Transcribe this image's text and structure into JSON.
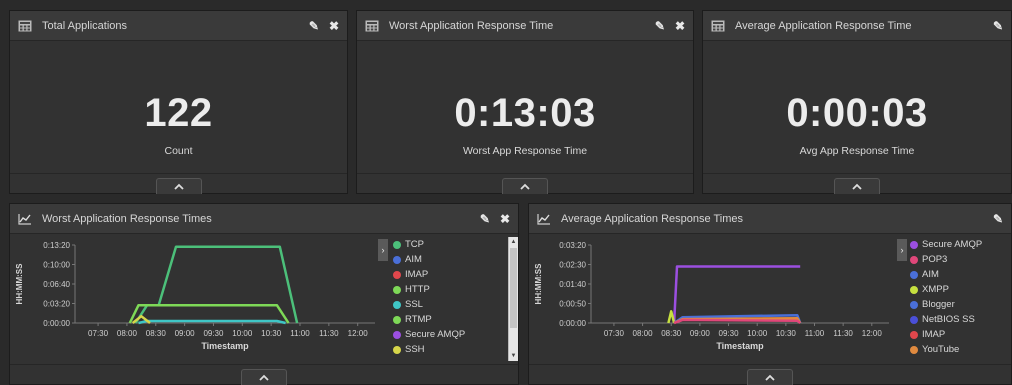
{
  "widgets": {
    "total_apps": {
      "title": "Total Applications",
      "value": "122",
      "label": "Count"
    },
    "worst_time": {
      "title": "Worst Application Response Time",
      "value": "0:13:03",
      "label": "Worst App Response Time"
    },
    "avg_time": {
      "title": "Average Application Response Time",
      "value": "0:00:03",
      "label": "Avg App Response Time"
    },
    "worst_chart": {
      "title": "Worst Application Response Times",
      "legend": [
        {
          "label": "TCP",
          "color": "#4cc07a"
        },
        {
          "label": "AIM",
          "color": "#4a6fd8"
        },
        {
          "label": "IMAP",
          "color": "#e0474c"
        },
        {
          "label": "HTTP",
          "color": "#7ed957"
        },
        {
          "label": "SSL",
          "color": "#3fc6c6"
        },
        {
          "label": "RTMP",
          "color": "#7ed957"
        },
        {
          "label": "Secure AMQP",
          "color": "#9b4fe0"
        },
        {
          "label": "SSH",
          "color": "#d6d64a"
        }
      ]
    },
    "avg_chart": {
      "title": "Average Application Response Times",
      "legend": [
        {
          "label": "Secure AMQP",
          "color": "#9b4fe0"
        },
        {
          "label": "POP3",
          "color": "#e0477a"
        },
        {
          "label": "AIM",
          "color": "#4a6fd8"
        },
        {
          "label": "XMPP",
          "color": "#c6e03f"
        },
        {
          "label": "Blogger",
          "color": "#4a6fd8"
        },
        {
          "label": "NetBIOS SS",
          "color": "#4a4fd8"
        },
        {
          "label": "IMAP",
          "color": "#e0474c"
        },
        {
          "label": "YouTube",
          "color": "#e08a3f"
        }
      ]
    }
  },
  "chart_data": [
    {
      "type": "line",
      "title": "Worst Application Response Times",
      "xlabel": "Timestamp",
      "ylabel": "HH:MM:SS",
      "x_ticks": [
        "07:30",
        "08:00",
        "08:30",
        "09:00",
        "09:30",
        "10:00",
        "10:30",
        "11:00",
        "11:30",
        "12:00"
      ],
      "y_ticks": [
        "0:00:00",
        "0:03:20",
        "0:06:40",
        "0:10:00",
        "0:13:20"
      ],
      "y_range_seconds": [
        0,
        800
      ],
      "x_range_hours": [
        7.1,
        12.3
      ],
      "series": [
        {
          "name": "TCP",
          "color": "#4cc07a",
          "points": [
            [
              8.15,
              0
            ],
            [
              8.35,
              183
            ],
            [
              8.55,
              183
            ],
            [
              8.85,
              783
            ],
            [
              10.65,
              783
            ],
            [
              10.95,
              0
            ]
          ]
        },
        {
          "name": "HTTP",
          "color": "#7ed957",
          "points": [
            [
              8.05,
              0
            ],
            [
              8.2,
              183
            ],
            [
              10.6,
              183
            ],
            [
              10.8,
              0
            ]
          ]
        },
        {
          "name": "SSL",
          "color": "#3fc6c6",
          "points": [
            [
              8.2,
              0
            ],
            [
              8.35,
              20
            ],
            [
              10.6,
              20
            ],
            [
              10.75,
              0
            ]
          ]
        },
        {
          "name": "SSH",
          "color": "#d6d64a",
          "points": [
            [
              8.1,
              0
            ],
            [
              8.25,
              70
            ],
            [
              8.4,
              0
            ]
          ]
        }
      ]
    },
    {
      "type": "line",
      "title": "Average Application Response Times",
      "xlabel": "Timestamp",
      "ylabel": "HH:MM:SS",
      "x_ticks": [
        "07:30",
        "08:00",
        "08:30",
        "09:00",
        "09:30",
        "10:00",
        "10:30",
        "11:00",
        "11:30",
        "12:00"
      ],
      "y_ticks": [
        "0:00:00",
        "0:00:50",
        "0:01:40",
        "0:02:30",
        "0:03:20"
      ],
      "y_range_seconds": [
        0,
        200
      ],
      "x_range_hours": [
        7.1,
        12.3
      ],
      "series": [
        {
          "name": "Secure AMQP",
          "color": "#9b4fe0",
          "points": [
            [
              8.55,
              0
            ],
            [
              8.6,
              145
            ],
            [
              10.75,
              145
            ]
          ]
        },
        {
          "name": "XMPP",
          "color": "#c6e03f",
          "points": [
            [
              8.45,
              0
            ],
            [
              8.5,
              30
            ],
            [
              8.55,
              0
            ]
          ]
        },
        {
          "name": "AIM",
          "color": "#4a6fd8",
          "points": [
            [
              8.55,
              0
            ],
            [
              8.7,
              15
            ],
            [
              10.7,
              20
            ],
            [
              10.75,
              0
            ]
          ]
        },
        {
          "name": "YouTube",
          "color": "#e08a3f",
          "points": [
            [
              8.55,
              0
            ],
            [
              8.7,
              10
            ],
            [
              10.7,
              12
            ],
            [
              10.75,
              0
            ]
          ]
        },
        {
          "name": "POP3",
          "color": "#e0477a",
          "points": [
            [
              8.55,
              0
            ],
            [
              8.7,
              8
            ],
            [
              10.7,
              6
            ],
            [
              10.75,
              0
            ]
          ]
        }
      ]
    }
  ]
}
